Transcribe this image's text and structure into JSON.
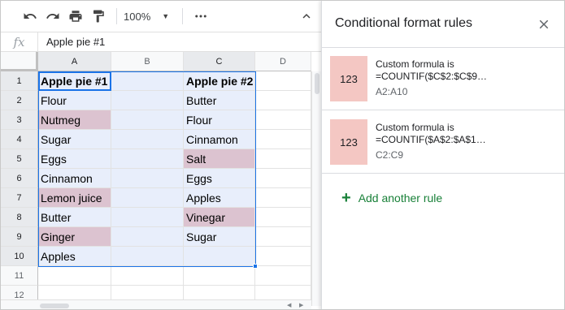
{
  "toolbar": {
    "zoom": "100%",
    "icons": [
      "undo-icon",
      "redo-icon",
      "print-icon",
      "paint-format-icon",
      "more-icon",
      "collapse-icon"
    ]
  },
  "formula_bar": {
    "fx": "fx",
    "value": "Apple pie #1"
  },
  "sheet": {
    "columns": [
      "A",
      "B",
      "C",
      "D"
    ],
    "rows": [
      "1",
      "2",
      "3",
      "4",
      "5",
      "6",
      "7",
      "8",
      "9",
      "10",
      "11",
      "12"
    ],
    "cells": {
      "A1": "Apple pie #1",
      "A2": "Flour",
      "A3": "Nutmeg",
      "A4": "Sugar",
      "A5": "Eggs",
      "A6": "Cinnamon",
      "A7": "Lemon juice",
      "A8": "Butter",
      "A9": "Ginger",
      "A10": "Apples",
      "C1": "Apple pie #2",
      "C2": "Butter",
      "C3": "Flour",
      "C4": "Cinnamon",
      "C5": "Salt",
      "C6": "Eggs",
      "C7": "Apples",
      "C8": "Vinegar",
      "C9": "Sugar"
    },
    "highlight_color": "#dcc3d0",
    "selection_color": "#e8eefb",
    "accent": "#1a73e8"
  },
  "panel": {
    "title": "Conditional format rules",
    "rules": [
      {
        "preview": "123",
        "line1": "Custom formula is",
        "line2": "=COUNTIF($C$2:$C$9…",
        "range": "A2:A10",
        "color": "#f4c7c3"
      },
      {
        "preview": "123",
        "line1": "Custom formula is",
        "line2": "=COUNTIF($A$2:$A$1…",
        "range": "C2:C9",
        "color": "#f4c7c3"
      }
    ],
    "add_rule_label": "Add another rule",
    "add_rule_color": "#188038"
  }
}
